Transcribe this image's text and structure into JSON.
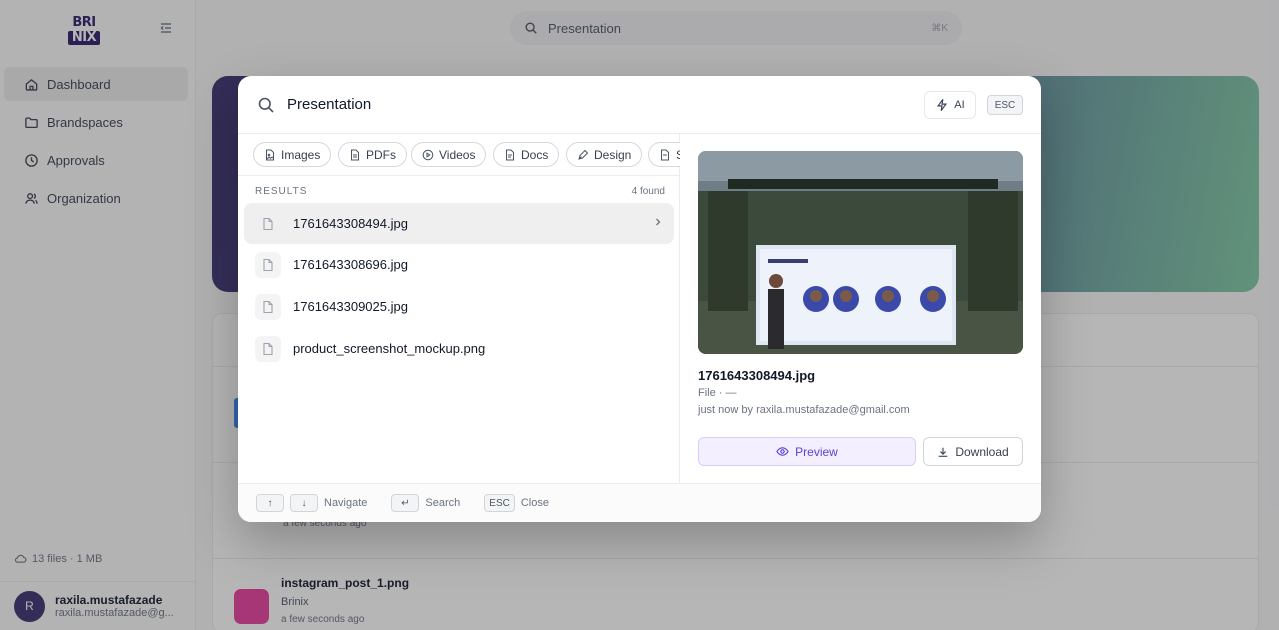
{
  "app": {
    "logo_top": "BRI",
    "logo_bottom": "NIX",
    "search_placeholder": "Presentation",
    "search_shortcut": "⌘K"
  },
  "sidebar": {
    "items": [
      {
        "label": "Dashboard",
        "icon": "home-icon",
        "active": true
      },
      {
        "label": "Brandspaces",
        "icon": "folder-icon"
      },
      {
        "label": "Approvals",
        "icon": "clock-icon"
      },
      {
        "label": "Organization",
        "icon": "people-icon"
      }
    ],
    "storage": "13 files · 1 MB",
    "user": {
      "initial": "R",
      "name": "raxila.mustafazade",
      "email": "raxila.mustafazade@g..."
    }
  },
  "background": {
    "time_above": "a few seconds ago",
    "file_name": "instagram_post_1.png",
    "file_space": "Brinix",
    "file_time": "a few seconds ago"
  },
  "modal": {
    "query": "Presentation",
    "ai_label": "AI",
    "esc_label": "ESC",
    "filters": [
      {
        "label": "Images",
        "icon": "image-file-icon"
      },
      {
        "label": "PDFs",
        "icon": "pdf-file-icon"
      },
      {
        "label": "Videos",
        "icon": "play-circle-icon"
      },
      {
        "label": "Docs",
        "icon": "doc-file-icon"
      },
      {
        "label": "Design",
        "icon": "pen-tool-icon"
      },
      {
        "label": "S",
        "icon": "doc-file-icon"
      }
    ],
    "results_label": "RESULTS",
    "results_count": "4 found",
    "results": [
      {
        "name": "1761643308494.jpg",
        "selected": true
      },
      {
        "name": "1761643308696.jpg"
      },
      {
        "name": "1761643309025.jpg"
      },
      {
        "name": "product_screenshot_mockup.png"
      }
    ],
    "preview": {
      "name": "1761643308494.jpg",
      "type": "File · —",
      "meta": "just now by raxila.mustafazade@gmail.com",
      "preview_label": "Preview",
      "download_label": "Download"
    },
    "footer": {
      "up_key": "↑",
      "down_key": "↓",
      "navigate": "Navigate",
      "enter_key": "↵",
      "search": "Search",
      "esc_key": "ESC",
      "close": "Close"
    }
  }
}
